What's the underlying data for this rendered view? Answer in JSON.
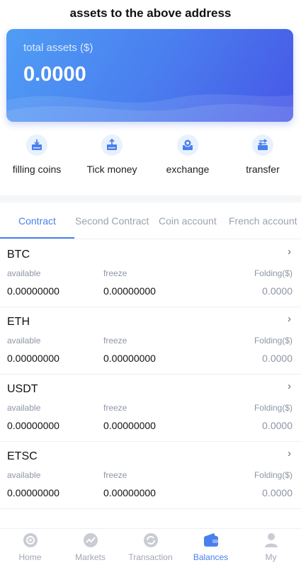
{
  "header": {
    "title": "assets to the above address"
  },
  "asset_card": {
    "label": "total assets ($)",
    "value": "0.0000"
  },
  "actions": [
    {
      "label": "filling coins",
      "icon": "deposit-icon"
    },
    {
      "label": "Tick money",
      "icon": "withdraw-icon"
    },
    {
      "label": "exchange",
      "icon": "exchange-icon"
    },
    {
      "label": "transfer",
      "icon": "transfer-icon"
    }
  ],
  "tabs": [
    {
      "label": "Contract",
      "active": true
    },
    {
      "label": "Second Contract",
      "active": false
    },
    {
      "label": "Coin account",
      "active": false
    },
    {
      "label": "French account",
      "active": false
    }
  ],
  "columns": {
    "available": "available",
    "freeze": "freeze",
    "folding": "Folding($)"
  },
  "coins": [
    {
      "name": "BTC",
      "available": "0.00000000",
      "freeze": "0.00000000",
      "folding": "0.0000"
    },
    {
      "name": "ETH",
      "available": "0.00000000",
      "freeze": "0.00000000",
      "folding": "0.0000"
    },
    {
      "name": "USDT",
      "available": "0.00000000",
      "freeze": "0.00000000",
      "folding": "0.0000"
    },
    {
      "name": "ETSC",
      "available": "0.00000000",
      "freeze": "0.00000000",
      "folding": "0.0000"
    }
  ],
  "nav": [
    {
      "label": "Home",
      "icon": "home-icon",
      "active": false
    },
    {
      "label": "Markets",
      "icon": "markets-icon",
      "active": false
    },
    {
      "label": "Transaction",
      "icon": "transaction-icon",
      "active": false
    },
    {
      "label": "Balances",
      "icon": "wallet-icon",
      "active": true
    },
    {
      "label": "My",
      "icon": "user-icon",
      "active": false
    }
  ],
  "colors": {
    "accent": "#4a7fef",
    "card_start": "#4f9df5",
    "card_end": "#4757e6",
    "muted": "#9aa2b1"
  }
}
